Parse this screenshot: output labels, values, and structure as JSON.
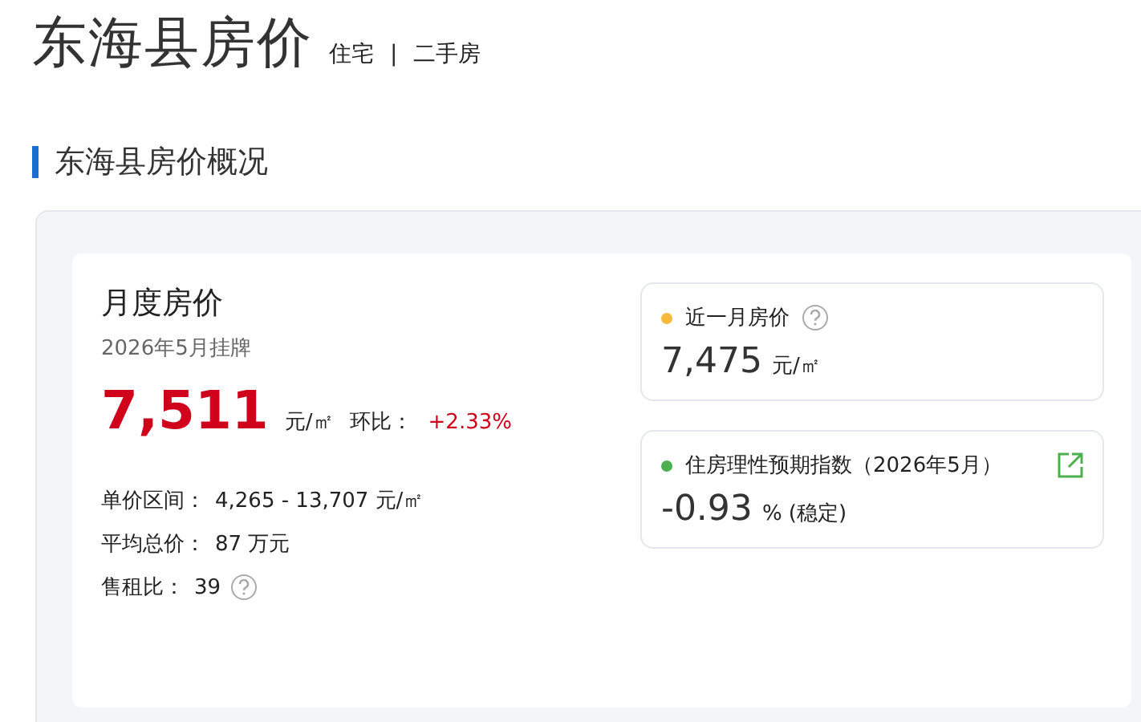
{
  "title": "东海县房价",
  "subtitle": [
    "住宅",
    "二手房"
  ],
  "subtitle_separator": "|",
  "section_title": "东海县房价概况",
  "monthly": {
    "title": "月度房价",
    "date": "2026年5月挂牌",
    "price": "7,511",
    "unit": "元/㎡",
    "change_label": "环比：",
    "change": "+2.33%",
    "details": [
      {
        "label": "单价区间：",
        "value": "4,265 - 13,707 元/㎡",
        "help": false
      },
      {
        "label": "平均总价：",
        "value": "87 万元",
        "help": false
      },
      {
        "label": "售租比：",
        "value": "39",
        "help": true
      }
    ]
  },
  "side_cards": [
    {
      "title": "近一月房价",
      "color": "#f6b93b",
      "help": true,
      "external_link": false,
      "value": "7,475",
      "unit": "元/㎡"
    },
    {
      "title": "住房理性预期指数（2026年5月）",
      "color": "#4caf50",
      "help": false,
      "external_link": true,
      "value": "-0.93",
      "unit": "% (稳定)"
    }
  ]
}
